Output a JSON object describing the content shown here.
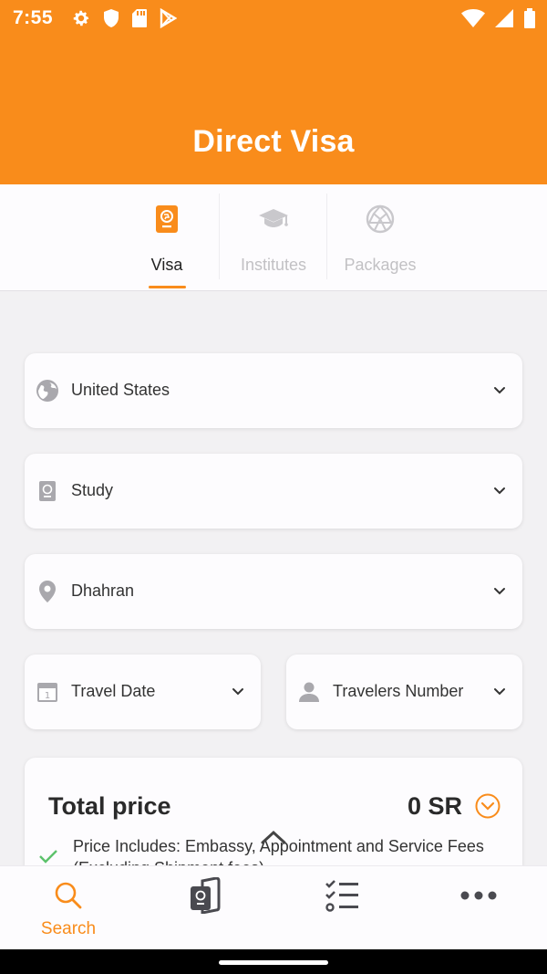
{
  "status_bar": {
    "time": "7:55",
    "left_icons": [
      "gear-icon",
      "shield-icon",
      "sd-card-icon",
      "play-store-icon"
    ],
    "right_icons": [
      "wifi-icon",
      "signal-icon",
      "battery-icon"
    ]
  },
  "header": {
    "title": "Direct Visa",
    "color": "#f98c1b"
  },
  "tabs": [
    {
      "label": "Visa",
      "icon": "passport-icon",
      "active": true
    },
    {
      "label": "Institutes",
      "icon": "graduation-cap-icon",
      "active": false
    },
    {
      "label": "Packages",
      "icon": "globe-icon",
      "active": false
    }
  ],
  "form": {
    "country": "United States",
    "visa_type": "Study",
    "city": "Dhahran",
    "travel_date": "Travel Date",
    "travelers": "Travelers Number"
  },
  "price": {
    "label": "Total price",
    "value": "0 SR",
    "note": "Price Includes: Embassy, Appointment and Service Fees",
    "note_line2": "(Excluding Shipment fees)"
  },
  "bottom_nav": [
    {
      "label": "Search",
      "icon": "search-icon",
      "active": true
    },
    {
      "label": "",
      "icon": "passport-card-icon",
      "active": false
    },
    {
      "label": "",
      "icon": "checklist-icon",
      "active": false
    },
    {
      "label": "",
      "icon": "more-icon",
      "active": false
    }
  ],
  "colors": {
    "accent": "#f98c1b",
    "check": "#5cc26b",
    "inactive_icon": "#c9c8cc",
    "field_icon": "#a9a8ad"
  }
}
